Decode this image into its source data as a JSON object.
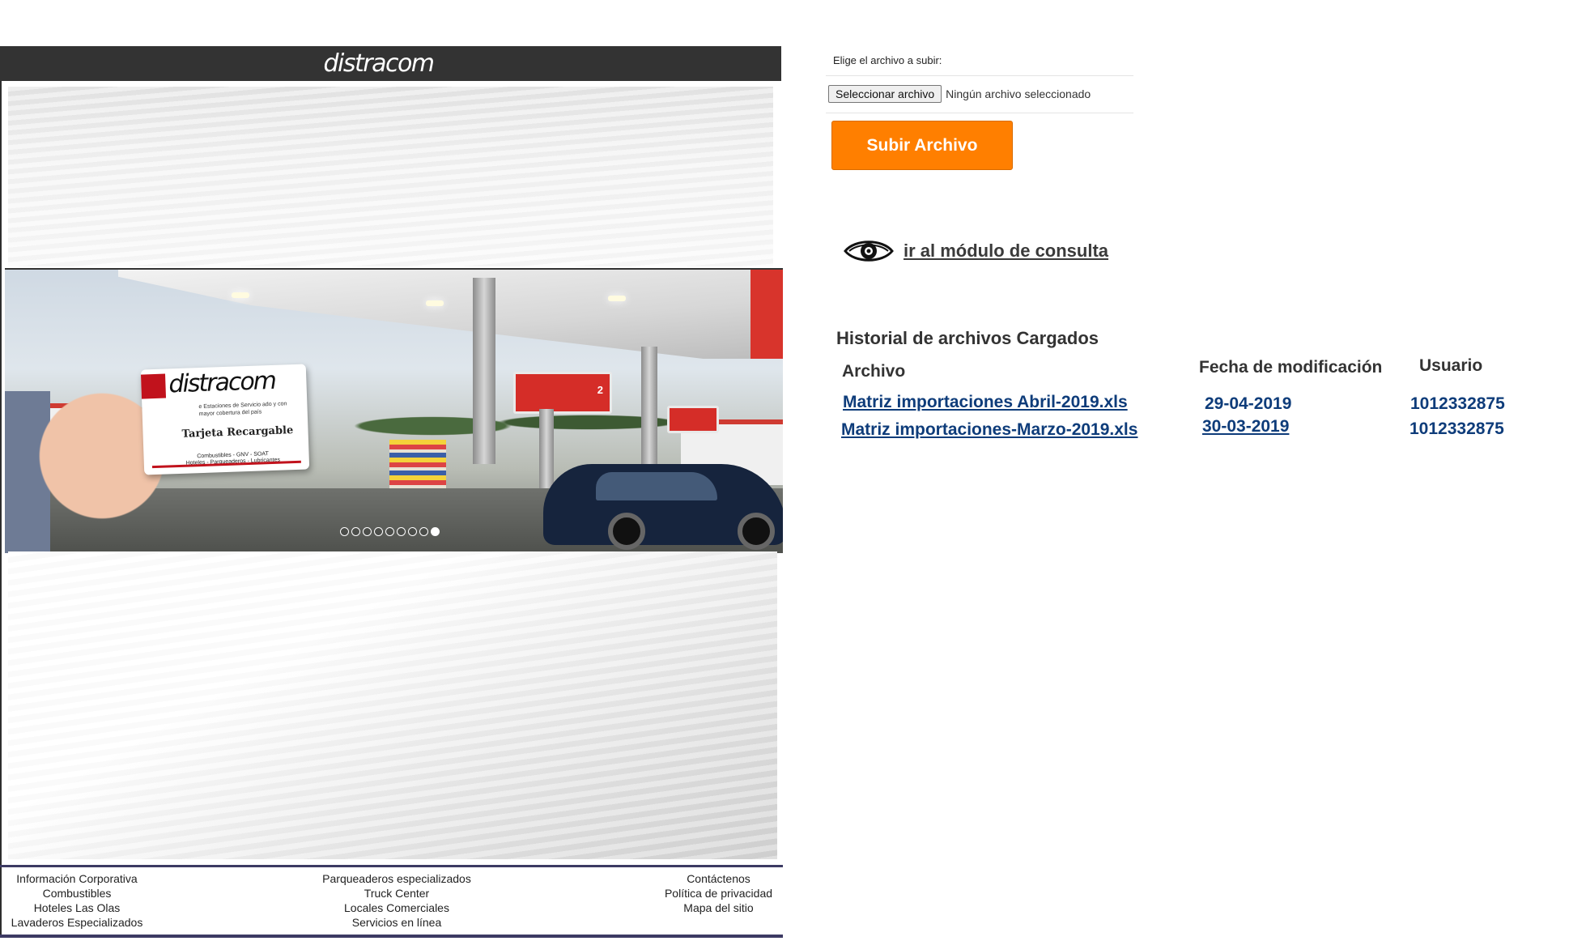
{
  "brand": {
    "logo": "distracom",
    "header_color": "#333333"
  },
  "promo_card": {
    "logo": "distracom",
    "fine_print": "e Estaciones de Servicio ado y con mayor cobertura del país",
    "title": "Tarjeta Recargable",
    "foot_line1": "Combustibles - GNV - SOAT",
    "foot_line2": "Hoteles - Parqueaderos - Lubricantes"
  },
  "station_signs": {
    "pump_number": "2"
  },
  "slider": {
    "total_slides": 9,
    "active_slide": 9
  },
  "footer": {
    "col1": [
      "Información Corporativa",
      "Combustibles",
      "Hoteles Las Olas",
      "Lavaderos Especializados"
    ],
    "col2": [
      "Parqueaderos especializados",
      "Truck Center",
      "Locales Comerciales",
      "Servicios en línea"
    ],
    "col3": [
      "Contáctenos",
      "Política de privacidad",
      "Mapa del sitio"
    ]
  },
  "upload": {
    "label": "Elige el archivo a subir:",
    "file_button": "Seleccionar archivo",
    "file_status": "Ningún archivo seleccionado",
    "submit_label": "Subir Archivo",
    "accent_color": "#ff7f00"
  },
  "query_link": {
    "label": "ir al módulo de consulta",
    "icon": "eye-icon"
  },
  "history": {
    "title": "Historial de archivos Cargados",
    "columns": {
      "file": "Archivo",
      "date": "Fecha de modificación",
      "user": "Usuario"
    },
    "rows": [
      {
        "file": "Matriz importaciones Abril-2019.xls",
        "date": "29-04-2019",
        "user": "1012332875"
      },
      {
        "file": "Matriz importaciones-Marzo-2019.xls",
        "date": "30-03-2019",
        "user": "1012332875"
      }
    ],
    "link_color": "#0e3c7a"
  }
}
